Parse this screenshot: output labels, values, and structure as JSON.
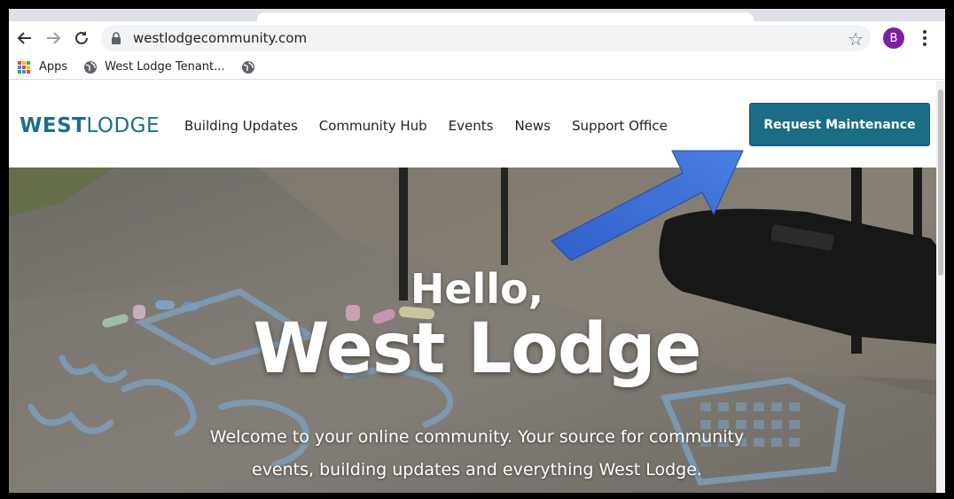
{
  "browser": {
    "url": "westlodgecommunity.com",
    "profile_initial": "B",
    "profile_color": "#7b1fa2",
    "bookmarks": [
      {
        "label": "Apps",
        "icon": "apps-grid-icon"
      },
      {
        "label": "West Lodge Tenant...",
        "icon": "globe-icon"
      },
      {
        "label": "",
        "icon": "globe-icon"
      }
    ]
  },
  "site": {
    "logo_bold": "WEST",
    "logo_light": "LODGE",
    "nav": [
      "Building Updates",
      "Community Hub",
      "Events",
      "News",
      "Support Office"
    ],
    "cta_label": "Request Maintenance",
    "brand_color": "#1a6d84",
    "hero": {
      "greeting": "Hello,",
      "title": "West Lodge",
      "subtitle_line1": "Welcome to your online community. Your source for community",
      "subtitle_line2": "events, building updates and everything West Lodge."
    }
  },
  "annotation": {
    "arrow_color": "#3b6fd6",
    "arrow_target": "Request Maintenance"
  }
}
